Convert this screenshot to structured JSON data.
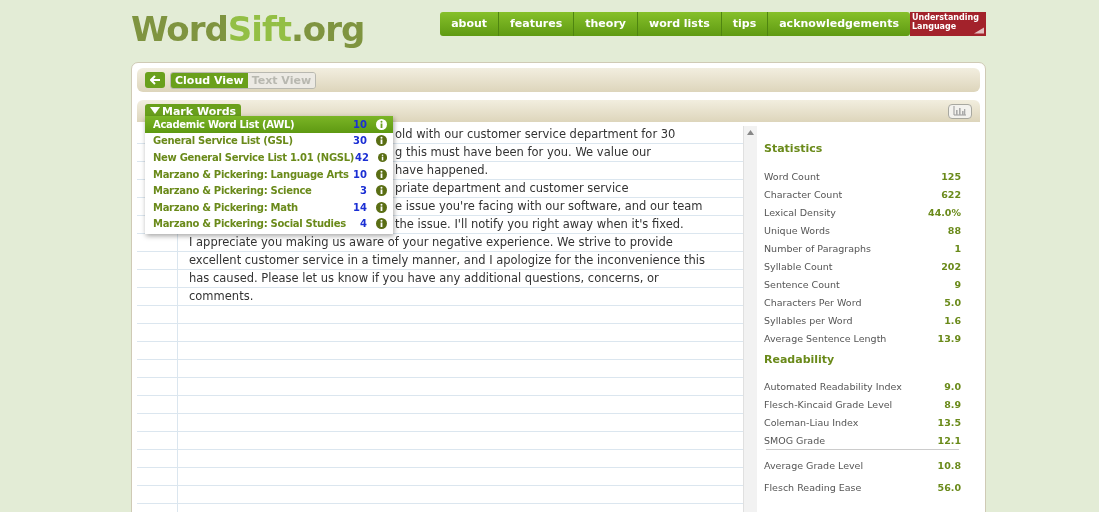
{
  "logo": {
    "parts": [
      "Word",
      "Sift",
      ".org"
    ]
  },
  "nav": [
    "about",
    "features",
    "theory",
    "word lists",
    "tips",
    "acknowledgements"
  ],
  "partner_logo": {
    "text": "Understanding Language"
  },
  "view_toggle": [
    {
      "label": "Cloud View",
      "selected": true
    },
    {
      "label": "Text View",
      "selected": false
    }
  ],
  "mark_words": {
    "label": "Mark Words",
    "expanded": true,
    "lists": [
      {
        "name": "Academic Word List (AWL)",
        "count": "10",
        "selected": true
      },
      {
        "name": "General Service List (GSL)",
        "count": "30",
        "selected": false
      },
      {
        "name": "New General Service List 1.01 (NGSL)",
        "count": "42",
        "selected": false
      },
      {
        "name": "Marzano & Pickering: Language Arts",
        "count": "10",
        "selected": false
      },
      {
        "name": "Marzano & Pickering: Science",
        "count": "3",
        "selected": false
      },
      {
        "name": "Marzano & Pickering: Math",
        "count": "14",
        "selected": false
      },
      {
        "name": "Marzano & Pickering: Social Studies",
        "count": "4",
        "selected": false
      }
    ]
  },
  "text_lines": [
    {
      "text": "old with our customer service department for 30",
      "covered": true
    },
    {
      "text": "g this must have been for you. We value our",
      "covered": true
    },
    {
      "text": "have happened.",
      "covered": true
    },
    {
      "text": "priate department and customer service",
      "covered": true
    },
    {
      "text": "e issue you're facing with our software, and our team",
      "covered": true
    },
    {
      "text": "the issue. I'll notify you right away when it's fixed.",
      "covered": true
    },
    {
      "text": "I appreciate you making us aware of your negative experience. We strive to provide",
      "covered": false
    },
    {
      "text": "excellent customer service in a timely manner, and I apologize for the inconvenience this",
      "covered": false
    },
    {
      "text": "has caused. Please let us know if you have any additional questions, concerns, or",
      "covered": false
    },
    {
      "text": "comments.",
      "covered": false
    }
  ],
  "statistics": {
    "title": "Statistics",
    "items": [
      {
        "label": "Word Count",
        "value": "125"
      },
      {
        "label": "Character Count",
        "value": "622"
      },
      {
        "label": "Lexical Density",
        "value": "44.0%"
      },
      {
        "label": "Unique Words",
        "value": "88"
      },
      {
        "label": "Number of Paragraphs",
        "value": "1"
      },
      {
        "label": "Syllable Count",
        "value": "202"
      },
      {
        "label": "Sentence Count",
        "value": "9"
      },
      {
        "label": "Characters Per Word",
        "value": "5.0"
      },
      {
        "label": "Syllables per Word",
        "value": "1.6"
      },
      {
        "label": "Average Sentence Length",
        "value": "13.9"
      }
    ]
  },
  "readability": {
    "title": "Readability",
    "items": [
      {
        "label": "Automated Readability Index",
        "value": "9.0"
      },
      {
        "label": "Flesch-Kincaid Grade Level",
        "value": "8.9"
      },
      {
        "label": "Coleman-Liau Index",
        "value": "13.5"
      },
      {
        "label": "SMOG Grade",
        "value": "12.1"
      }
    ],
    "summary": [
      {
        "label": "Average Grade Level",
        "value": "10.8"
      },
      {
        "label": "Flesch Reading Ease",
        "value": "56.0"
      }
    ]
  }
}
